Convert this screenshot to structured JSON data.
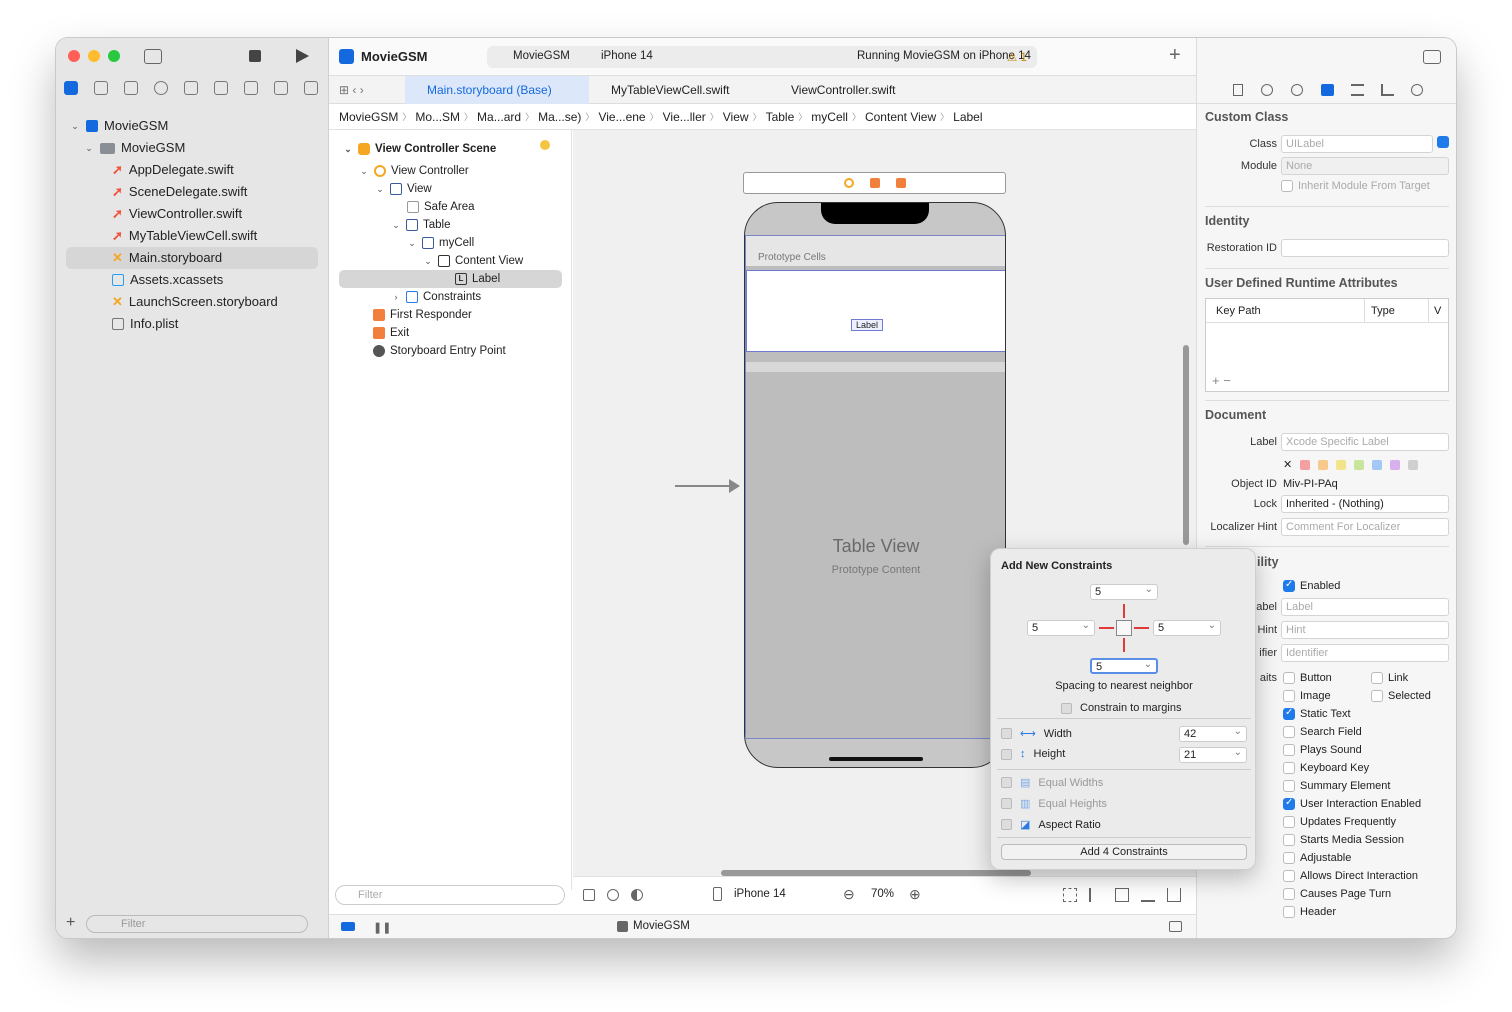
{
  "toolbar": {
    "app_title": "MovieGSM",
    "scheme": "MovieGSM",
    "device": "iPhone 14",
    "status": "Running MovieGSM on iPhone 14",
    "warnings": "1"
  },
  "nav": {
    "items": [
      {
        "label": "MovieGSM",
        "type": "project"
      },
      {
        "label": "MovieGSM",
        "type": "folder"
      },
      {
        "label": "AppDelegate.swift",
        "type": "swift"
      },
      {
        "label": "SceneDelegate.swift",
        "type": "swift"
      },
      {
        "label": "ViewController.swift",
        "type": "swift"
      },
      {
        "label": "MyTableViewCell.swift",
        "type": "swift"
      },
      {
        "label": "Main.storyboard",
        "type": "storyboard"
      },
      {
        "label": "Assets.xcassets",
        "type": "assets"
      },
      {
        "label": "LaunchScreen.storyboard",
        "type": "storyboard"
      },
      {
        "label": "Info.plist",
        "type": "plist"
      }
    ],
    "filter_placeholder": "Filter"
  },
  "tabs": [
    "Main.storyboard (Base)",
    "MyTableViewCell.swift",
    "ViewController.swift"
  ],
  "jumpbar": [
    "MovieGSM",
    "Mo...SM",
    "Ma...ard",
    "Ma...se)",
    "Vie...ene",
    "Vie...ller",
    "View",
    "Table",
    "myCell",
    "Content View",
    "Label"
  ],
  "outline": {
    "items": [
      "View Controller Scene",
      "View Controller",
      "View",
      "Safe Area",
      "Table",
      "myCell",
      "Content View",
      "Label",
      "Constraints",
      "First Responder",
      "Exit",
      "Storyboard Entry Point"
    ],
    "filter_placeholder": "Filter"
  },
  "canvas": {
    "prototype_cells": "Prototype Cells",
    "cell_label": "Label",
    "table_view": "Table View",
    "prototype_content": "Prototype Content",
    "device": "iPhone 14",
    "zoom": "70%"
  },
  "debug": {
    "target": "MovieGSM"
  },
  "popover": {
    "title": "Add New Constraints",
    "top": "5",
    "left": "5",
    "right": "5",
    "bottom": "5",
    "spacing_label": "Spacing to nearest neighbor",
    "constrain_margins": "Constrain to margins",
    "width_label": "Width",
    "width_value": "42",
    "height_label": "Height",
    "height_value": "21",
    "equal_widths": "Equal Widths",
    "equal_heights": "Equal Heights",
    "aspect_ratio": "Aspect Ratio",
    "add_button": "Add 4 Constraints"
  },
  "inspector": {
    "custom_class": "Custom Class",
    "class_label": "Class",
    "class_placeholder": "UILabel",
    "module_label": "Module",
    "module_placeholder": "None",
    "inherit": "Inherit Module From Target",
    "identity": "Identity",
    "restoration_label": "Restoration ID",
    "udra": "User Defined Runtime Attributes",
    "key_path": "Key Path",
    "type": "Type",
    "v": "V",
    "document": "Document",
    "doc_label": "Label",
    "doc_label_placeholder": "Xcode Specific Label",
    "object_id_label": "Object ID",
    "object_id": "Miv-PI-PAq",
    "lock_label": "Lock",
    "lock_value": "Inherited - (Nothing)",
    "localizer_label": "Localizer Hint",
    "localizer_placeholder": "Comment For Localizer",
    "accessibility": "ility",
    "enabled": "Enabled",
    "acc_label": "abel",
    "acc_label_ph": "Label",
    "hint": "Hint",
    "hint_ph": "Hint",
    "ident": "ifier",
    "ident_ph": "Identifier",
    "traits": "aits",
    "traits_left": [
      {
        "t": "Button",
        "on": false
      },
      {
        "t": "Image",
        "on": false
      },
      {
        "t": "Static Text",
        "on": true
      },
      {
        "t": "Search Field",
        "on": false
      },
      {
        "t": "Plays Sound",
        "on": false
      },
      {
        "t": "Keyboard Key",
        "on": false
      },
      {
        "t": "Summary Element",
        "on": false
      },
      {
        "t": "User Interaction Enabled",
        "on": true
      },
      {
        "t": "Updates Frequently",
        "on": false
      },
      {
        "t": "Starts Media Session",
        "on": false
      },
      {
        "t": "Adjustable",
        "on": false
      },
      {
        "t": "Allows Direct Interaction",
        "on": false
      },
      {
        "t": "Causes Page Turn",
        "on": false
      },
      {
        "t": "Header",
        "on": false
      }
    ],
    "traits_right": [
      {
        "t": "Link",
        "on": false
      },
      {
        "t": "Selected",
        "on": false
      }
    ]
  },
  "colors": {
    "accent": "#1469de",
    "swift": "#f05138",
    "storyboard": "#f5a623"
  }
}
